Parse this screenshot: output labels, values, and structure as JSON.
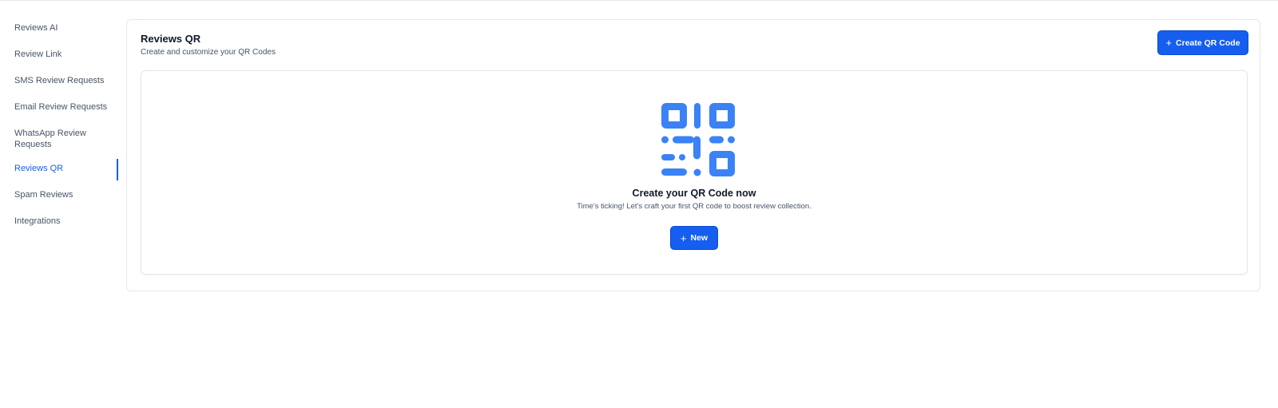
{
  "sidebar": {
    "items": [
      {
        "label": "Reviews AI"
      },
      {
        "label": "Review Link"
      },
      {
        "label": "SMS Review Requests"
      },
      {
        "label": "Email Review Requests"
      },
      {
        "label": "WhatsApp Review Requests"
      },
      {
        "label": "Reviews QR",
        "active": true
      },
      {
        "label": "Spam Reviews"
      },
      {
        "label": "Integrations"
      }
    ]
  },
  "header": {
    "title": "Reviews QR",
    "subtitle": "Create and customize your QR Codes",
    "create_button_label": "Create QR Code",
    "create_button_icon": "plus-icon"
  },
  "empty_state": {
    "illustration_icon": "qr-code-icon",
    "title": "Create your QR Code now",
    "description": "Time's ticking! Let's craft your first QR code to boost review collection.",
    "new_button_label": "New",
    "new_button_icon": "plus-icon"
  },
  "colors": {
    "accent": "#155eef",
    "illustration": "#3b82f6",
    "border": "#e4e7ec",
    "text_primary": "#101828",
    "text_secondary": "#475467"
  }
}
